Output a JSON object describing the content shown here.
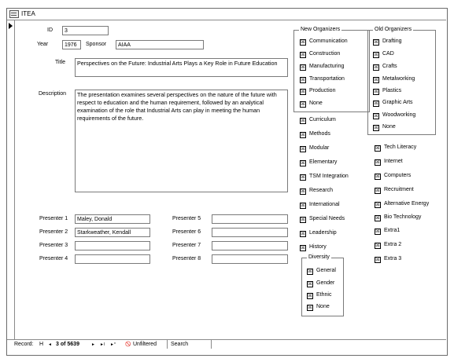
{
  "window": {
    "title": "ITEA"
  },
  "fields": {
    "id_label": "ID",
    "id_value": "3",
    "year_label": "Year",
    "year_value": "1976",
    "sponsor_label": "Sponsor",
    "sponsor_value": "AIAA",
    "title_label": "Title",
    "title_value": "Perspectives on the Future: Industrial Arts Plays a Key Role in Future Education",
    "description_label": "Description",
    "description_value": "The presentation examines several perspectives on the nature of the future with respect to education and the human requirement, followed by an analytical examination of the role that Industrial Arts can play in meeting the human requirements of the future."
  },
  "presenters": [
    {
      "label": "Presenter 1",
      "value": "Maley, Donald"
    },
    {
      "label": "Presenter 2",
      "value": "Starkweather, Kendall"
    },
    {
      "label": "Presenter 3",
      "value": ""
    },
    {
      "label": "Presenter 4",
      "value": ""
    },
    {
      "label": "Presenter 5",
      "value": ""
    },
    {
      "label": "Presenter 6",
      "value": ""
    },
    {
      "label": "Presenter 7",
      "value": ""
    },
    {
      "label": "Presenter 8",
      "value": ""
    }
  ],
  "new_organizers": {
    "legend": "New Organizers",
    "items": [
      "Communication",
      "Construction",
      "Manufacturing",
      "Transportation",
      "Production",
      "None"
    ]
  },
  "old_organizers": {
    "legend": "Old Organizers",
    "items": [
      "Drafting",
      "CAD",
      "Crafts",
      "Metalworking",
      "Plastics",
      "Graphic Arts",
      "Woodworking",
      "None"
    ]
  },
  "topics_left": [
    "Curriculum",
    "Methods",
    "Modular",
    "Elementary",
    "TSM Integration",
    "Research",
    "International",
    "Special Needs",
    "Leadership",
    "History"
  ],
  "topics_right": [
    "Tech Literacy",
    "Internet",
    "Computers",
    "Recruitment",
    "Alternative Energy",
    "Bio Technology",
    "Extra1",
    "Extra 2",
    "Extra 3"
  ],
  "diversity": {
    "legend": "Diversity",
    "items": [
      "General",
      "Gender",
      "Ethnic",
      "None"
    ]
  },
  "navigation": {
    "record_label": "Record:",
    "first": "H",
    "prev": "◄",
    "position": "3 of 5639",
    "next": "►",
    "last": "►I",
    "new": "►*",
    "filter_icon": "🚫",
    "filter": "Unfiltered",
    "search": "Search"
  }
}
